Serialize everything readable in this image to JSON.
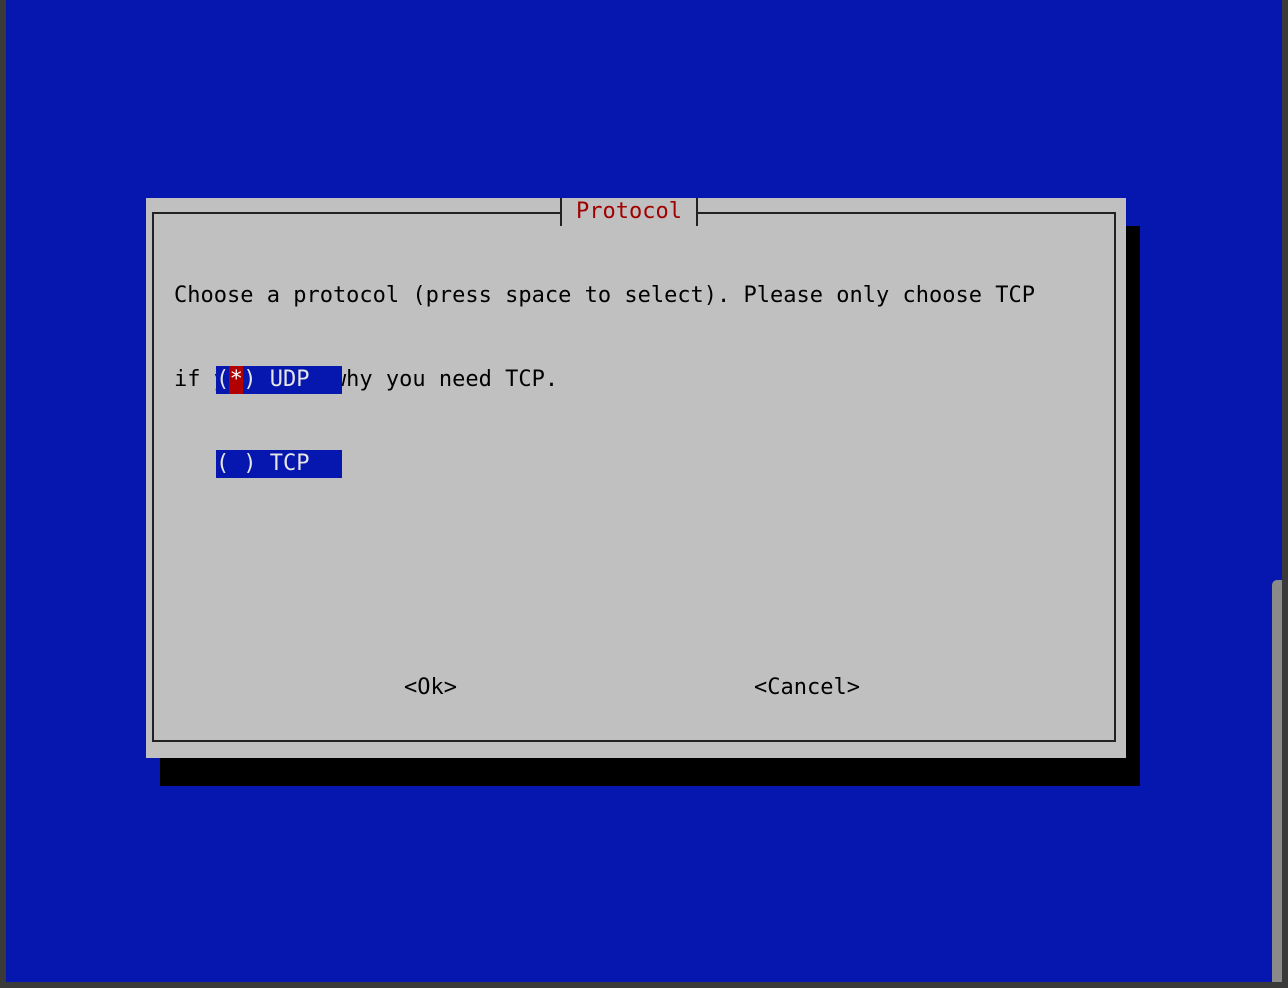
{
  "dialog": {
    "title": "Protocol",
    "prompt_line1": "Choose a protocol (press space to select). Please only choose TCP",
    "prompt_line2": "if you know why you need TCP."
  },
  "options": [
    {
      "open": "(",
      "mark": "*",
      "close": ")",
      "label": " UDP",
      "selected": true
    },
    {
      "open": "(",
      "mark": " ",
      "close": ")",
      "label": " TCP",
      "selected": false
    }
  ],
  "buttons": {
    "ok": "<Ok>",
    "cancel": "<Cancel>"
  },
  "colors": {
    "background": "#0617b0",
    "dialog": "#c0c0c0",
    "title": "#a00000",
    "selection": "#0617b0",
    "cursor": "#b00000"
  }
}
